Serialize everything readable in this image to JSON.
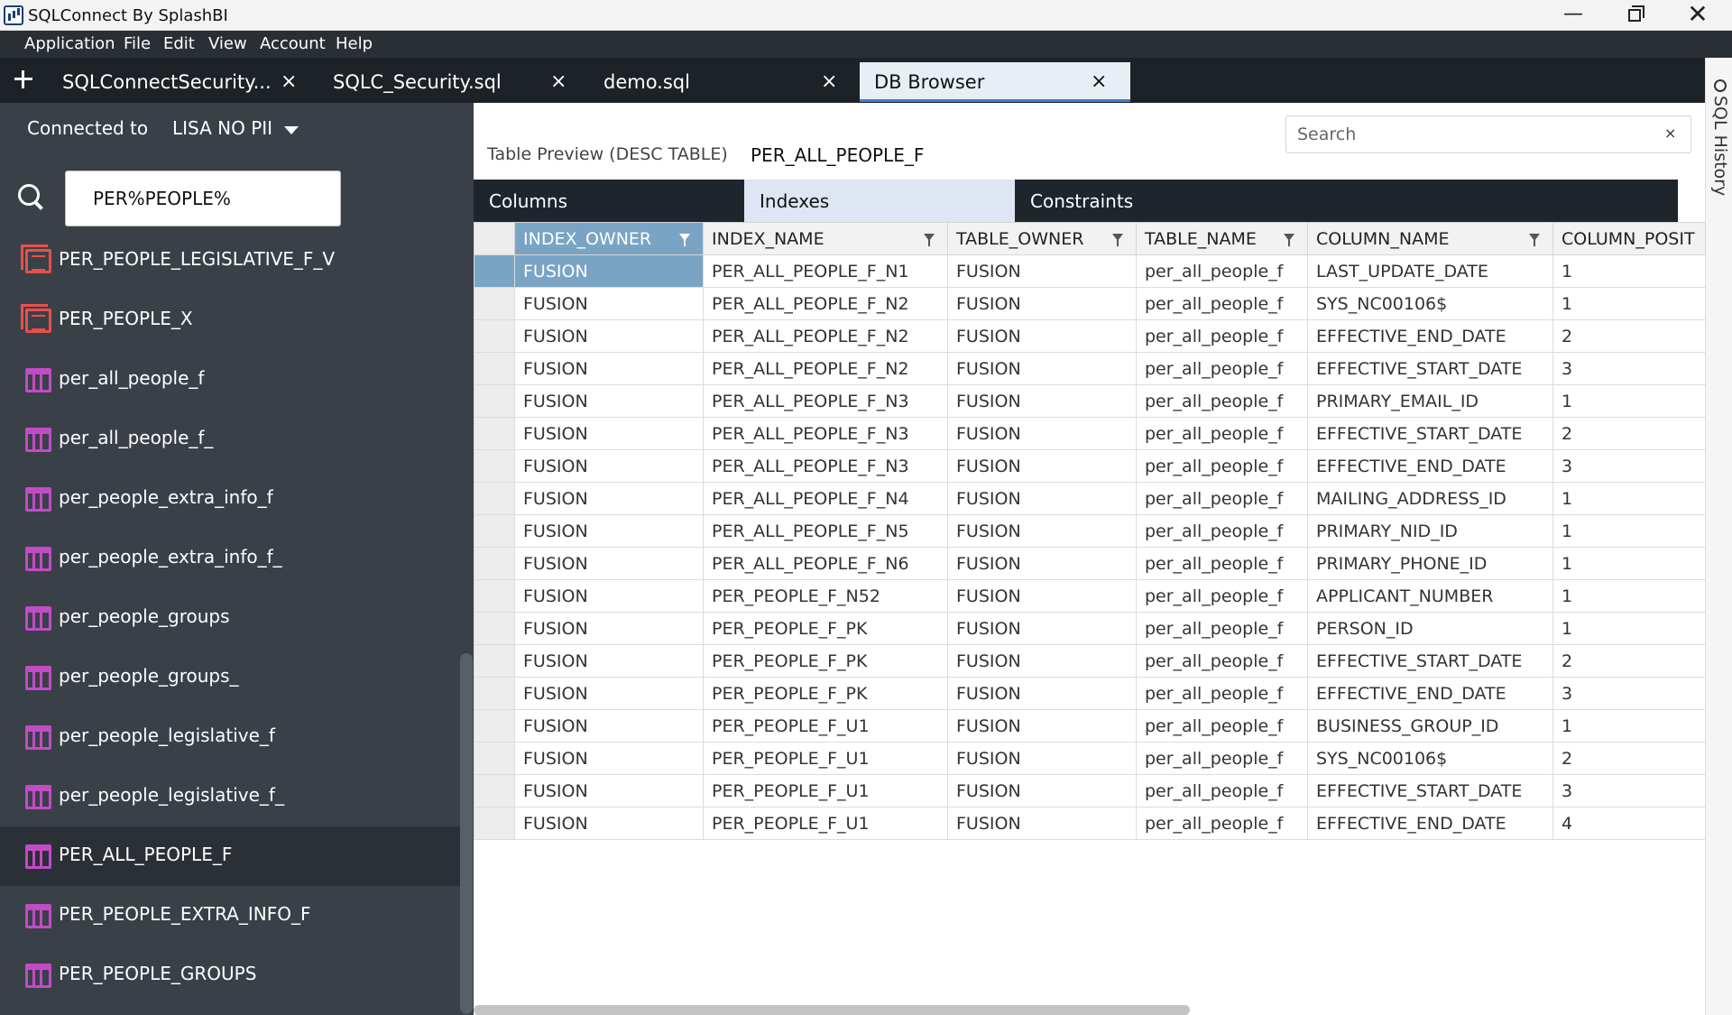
{
  "window": {
    "title": "SQLConnect By SplashBI"
  },
  "menu": [
    "Application",
    "File",
    "Edit",
    "View",
    "Account",
    "Help"
  ],
  "tabs": [
    {
      "label": "SQLConnectSecurity...",
      "active": false
    },
    {
      "label": "SQLC_Security.sql",
      "active": false
    },
    {
      "label": "demo.sql",
      "active": false
    },
    {
      "label": "DB Browser",
      "active": true
    }
  ],
  "tab_close_glyph": "×",
  "rail": {
    "label": "SQL History",
    "icon": "history-icon"
  },
  "sidebar": {
    "connected_label": "Connected to",
    "connection": "LISA NO PII",
    "search_value": "PER%PEOPLE%",
    "items": [
      {
        "label": "PER_PEOPLE_LEGISLATIVE_F_V",
        "icon": "view-icon",
        "selected": false
      },
      {
        "label": "PER_PEOPLE_X",
        "icon": "view-icon",
        "selected": false
      },
      {
        "label": "per_all_people_f",
        "icon": "table-icon",
        "selected": false
      },
      {
        "label": "per_all_people_f_",
        "icon": "table-icon",
        "selected": false
      },
      {
        "label": "per_people_extra_info_f",
        "icon": "table-icon",
        "selected": false
      },
      {
        "label": "per_people_extra_info_f_",
        "icon": "table-icon",
        "selected": false
      },
      {
        "label": "per_people_groups",
        "icon": "table-icon",
        "selected": false
      },
      {
        "label": "per_people_groups_",
        "icon": "table-icon",
        "selected": false
      },
      {
        "label": "per_people_legislative_f",
        "icon": "table-icon",
        "selected": false
      },
      {
        "label": "per_people_legislative_f_",
        "icon": "table-icon",
        "selected": false
      },
      {
        "label": "PER_ALL_PEOPLE_F",
        "icon": "table-icon",
        "selected": true
      },
      {
        "label": "PER_PEOPLE_EXTRA_INFO_F",
        "icon": "table-icon",
        "selected": false
      },
      {
        "label": "PER_PEOPLE_GROUPS",
        "icon": "table-icon",
        "selected": false
      }
    ]
  },
  "main": {
    "preview_label": "Table Preview (DESC TABLE)",
    "table_name": "PER_ALL_PEOPLE_F",
    "search_placeholder": "Search",
    "search_clear": "×",
    "subtabs": [
      {
        "label": "Columns",
        "active": false
      },
      {
        "label": "Indexes",
        "active": true
      },
      {
        "label": "Constraints",
        "active": false
      }
    ],
    "grid": {
      "columns": [
        "INDEX_OWNER",
        "INDEX_NAME",
        "TABLE_OWNER",
        "TABLE_NAME",
        "COLUMN_NAME",
        "COLUMN_POSIT"
      ],
      "sorted_column": 0,
      "selected_row": 0,
      "rows": [
        [
          "FUSION",
          "PER_ALL_PEOPLE_F_N1",
          "FUSION",
          "per_all_people_f",
          "LAST_UPDATE_DATE",
          "1"
        ],
        [
          "FUSION",
          "PER_ALL_PEOPLE_F_N2",
          "FUSION",
          "per_all_people_f",
          "SYS_NC00106$",
          "1"
        ],
        [
          "FUSION",
          "PER_ALL_PEOPLE_F_N2",
          "FUSION",
          "per_all_people_f",
          "EFFECTIVE_END_DATE",
          "2"
        ],
        [
          "FUSION",
          "PER_ALL_PEOPLE_F_N2",
          "FUSION",
          "per_all_people_f",
          "EFFECTIVE_START_DATE",
          "3"
        ],
        [
          "FUSION",
          "PER_ALL_PEOPLE_F_N3",
          "FUSION",
          "per_all_people_f",
          "PRIMARY_EMAIL_ID",
          "1"
        ],
        [
          "FUSION",
          "PER_ALL_PEOPLE_F_N3",
          "FUSION",
          "per_all_people_f",
          "EFFECTIVE_START_DATE",
          "2"
        ],
        [
          "FUSION",
          "PER_ALL_PEOPLE_F_N3",
          "FUSION",
          "per_all_people_f",
          "EFFECTIVE_END_DATE",
          "3"
        ],
        [
          "FUSION",
          "PER_ALL_PEOPLE_F_N4",
          "FUSION",
          "per_all_people_f",
          "MAILING_ADDRESS_ID",
          "1"
        ],
        [
          "FUSION",
          "PER_ALL_PEOPLE_F_N5",
          "FUSION",
          "per_all_people_f",
          "PRIMARY_NID_ID",
          "1"
        ],
        [
          "FUSION",
          "PER_ALL_PEOPLE_F_N6",
          "FUSION",
          "per_all_people_f",
          "PRIMARY_PHONE_ID",
          "1"
        ],
        [
          "FUSION",
          "PER_PEOPLE_F_N52",
          "FUSION",
          "per_all_people_f",
          "APPLICANT_NUMBER",
          "1"
        ],
        [
          "FUSION",
          "PER_PEOPLE_F_PK",
          "FUSION",
          "per_all_people_f",
          "PERSON_ID",
          "1"
        ],
        [
          "FUSION",
          "PER_PEOPLE_F_PK",
          "FUSION",
          "per_all_people_f",
          "EFFECTIVE_START_DATE",
          "2"
        ],
        [
          "FUSION",
          "PER_PEOPLE_F_PK",
          "FUSION",
          "per_all_people_f",
          "EFFECTIVE_END_DATE",
          "3"
        ],
        [
          "FUSION",
          "PER_PEOPLE_F_U1",
          "FUSION",
          "per_all_people_f",
          "BUSINESS_GROUP_ID",
          "1"
        ],
        [
          "FUSION",
          "PER_PEOPLE_F_U1",
          "FUSION",
          "per_all_people_f",
          "SYS_NC00106$",
          "2"
        ],
        [
          "FUSION",
          "PER_PEOPLE_F_U1",
          "FUSION",
          "per_all_people_f",
          "EFFECTIVE_START_DATE",
          "3"
        ],
        [
          "FUSION",
          "PER_PEOPLE_F_U1",
          "FUSION",
          "per_all_people_f",
          "EFFECTIVE_END_DATE",
          "4"
        ]
      ]
    }
  },
  "colors": {
    "accent": "#3a7fd0",
    "selected_cell": "#7aa4c4",
    "table_icon": "#c24bc6",
    "view_icon": "#e8504a",
    "sidebar_bg": "#3a4048"
  }
}
